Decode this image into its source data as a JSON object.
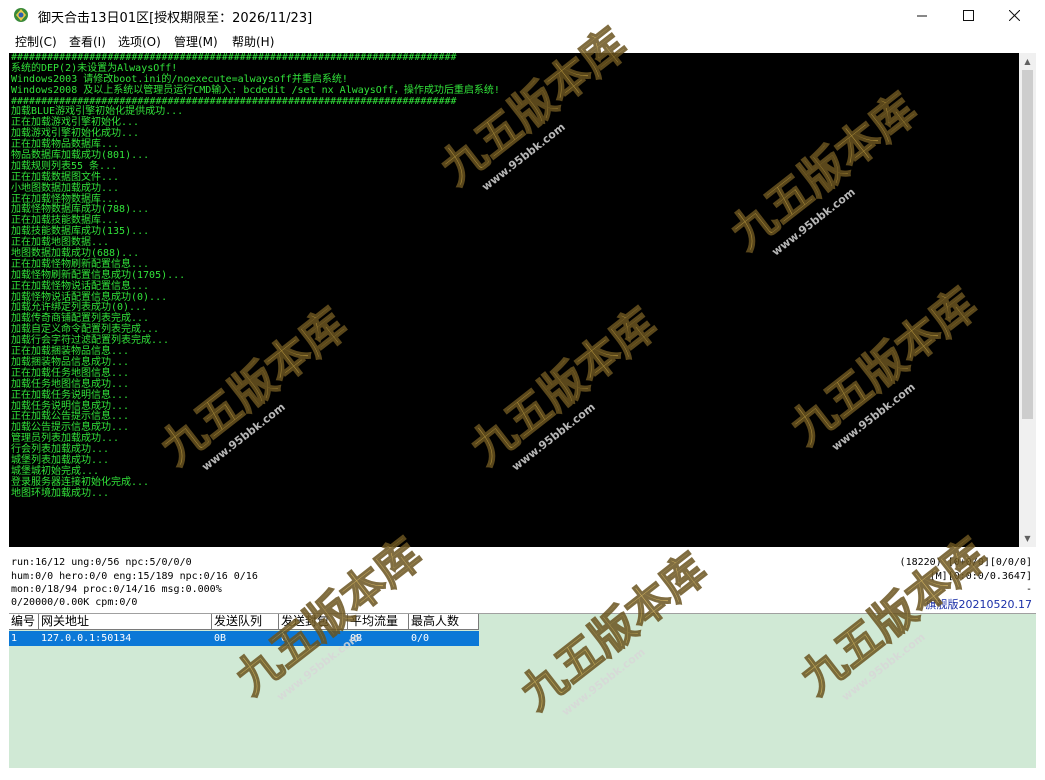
{
  "window": {
    "title": "御天合击13日01区[授权期限至：2026/11/23]",
    "minimize_icon": "minimize-icon",
    "maximize_icon": "maximize-icon",
    "close_icon": "close-icon"
  },
  "menu": [
    "控制(C)",
    "查看(I)",
    "选项(O)",
    "管理(M)",
    "帮助(H)"
  ],
  "console": {
    "lines": [
      "##########################################################################",
      "系统的DEP(2)未设置为AlwaysOff!",
      "Windows2003 请修改boot.ini的/noexecute=alwaysoff并重启系统!",
      "Windows2008 及以上系统以管理员运行CMD输入: bcdedit /set nx AlwaysOff，操作成功后重启系统!",
      "##########################################################################",
      "加载BLUE游戏引擎初始化提供成功...",
      "正在加载游戏引擎初始化...",
      "加载游戏引擎初始化成功...",
      "正在加载物品数据库...",
      "物品数据库加载成功(801)...",
      "加载规则列表55 条...",
      "正在加载数据图文件...",
      "小地图数据加载成功...",
      "正在加载怪物数据库...",
      "加载怪物数据库成功(788)...",
      "正在加载技能数据库...",
      "加载技能数据库成功(135)...",
      "正在加载地图数据...",
      "地图数据加载成功(688)...",
      "正在加载怪物刷新配置信息...",
      "加载怪物刷新配置信息成功(1705)...",
      "正在加载怪物说话配置信息...",
      "加载怪物说话配置信息成功(0)...",
      "加载允许绑定列表成功(0)...",
      "加载传奇商铺配置列表完成...",
      "加载自定义命令配置列表完成...",
      "加载行会字符过滤配置列表完成...",
      "正在加载捆装物品信息...",
      "加载捆装物品信息成功...",
      "正在加载任务地图信息...",
      "加载任务地图信息成功...",
      "正在加载任务说明信息...",
      "加载任务说明信息成功...",
      "正在加载公告提示信息...",
      "加载公告提示信息成功...",
      "管理员列表加载成功...",
      "行会列表加载成功...",
      "城堡列表加载成功...",
      "城堡城初始完成...",
      "登录服务器连接初始化完成...",
      "地图环境加载成功..."
    ]
  },
  "status": {
    "line1": "run:16/12 ung:0/56 npc:5/0/0/0",
    "line2": "hum:0/0 hero:0/0 eng:15/189 npc:0/16 0/16",
    "line3": "mon:0/18/94 proc:0/14/16 msg:0.000%",
    "line4": "0/20000/0.00K cpm:0/0",
    "right1": "(18220) [0+0/0][0/0/0]",
    "right2": "[M][0:0:0/0.3647]",
    "right3": "-",
    "version": "旗舰版20210520.17"
  },
  "gateway_table": {
    "headers": [
      "编号",
      "网关地址",
      "发送队列",
      "发送封包",
      "平均流量",
      "最高人数"
    ],
    "rows": [
      [
        "1",
        "127.0.0.1:50134",
        "0B",
        "0",
        "0B",
        "0/0"
      ]
    ]
  },
  "watermark": {
    "logo_text": "九五版本库",
    "site": "www.95bbk.com"
  },
  "colors": {
    "console_bg": "#000000",
    "console_text": "#31e33a",
    "grid_bg": "#d0e9d5",
    "selection": "#0b78d7",
    "version_text": "#1a2fa8",
    "watermark_gold": "#c9a545"
  }
}
